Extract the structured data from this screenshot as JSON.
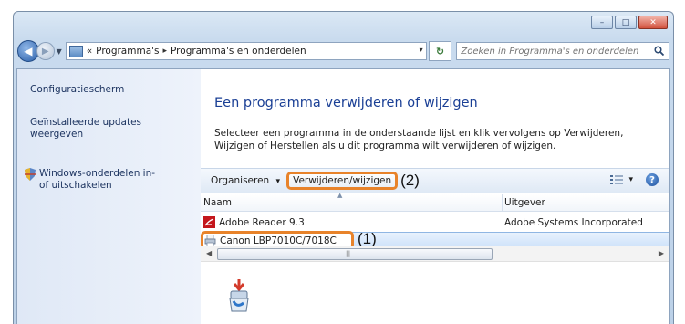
{
  "window": {
    "controls": [
      "–",
      "□",
      "✕"
    ]
  },
  "nav": {
    "back_glyph": "◀",
    "forward_glyph": "▶",
    "dropdown_glyph": "▼",
    "breadcrumb_prefix": "«",
    "breadcrumb": [
      "Programma's",
      "Programma's en onderdelen"
    ],
    "crumb_separator": "▸",
    "address_arrow": "▾",
    "refresh_glyph": "↻",
    "search_placeholder": "Zoeken in Programma's en onderdelen"
  },
  "sidebar": {
    "items": [
      {
        "label": "Configuratiescherm",
        "icon": null
      },
      {
        "label": "Geïnstalleerde updates weergeven",
        "icon": null
      },
      {
        "label": "Windows-onderdelen in- of uitschakelen",
        "icon": "shield-icon"
      }
    ]
  },
  "main": {
    "title": "Een programma verwijderen of wijzigen",
    "description": "Selecteer een programma in de onderstaande lijst en klik vervolgens op Verwijderen, Wijzigen of Herstellen als u dit programma wilt verwijderen of wijzigen."
  },
  "toolbar": {
    "organize_label": "Organiseren",
    "organize_arrow": "▾",
    "uninstall_label": "Verwijderen/wijzigen",
    "callout_2": "(2)",
    "views_arrow": "▾",
    "help_glyph": "?"
  },
  "list": {
    "columns": [
      "Naam",
      "Uitgever"
    ],
    "sort_glyph": "▲",
    "rows": [
      {
        "name": "Adobe Reader 9.3",
        "publisher": "Adobe Systems Incorporated",
        "icon": "adobe-reader-icon",
        "selected": false
      },
      {
        "name": "Canon LBP7010C/7018C",
        "publisher": "",
        "icon": "printer-icon",
        "selected": true
      }
    ],
    "callout_1": "(1)"
  },
  "scrollbar": {
    "left_glyph": "◀",
    "right_glyph": "▶",
    "grip": "|||"
  },
  "colors": {
    "highlight_outline": "#e8832a",
    "title_blue": "#1a3f95",
    "link_blue": "#1d3460"
  }
}
